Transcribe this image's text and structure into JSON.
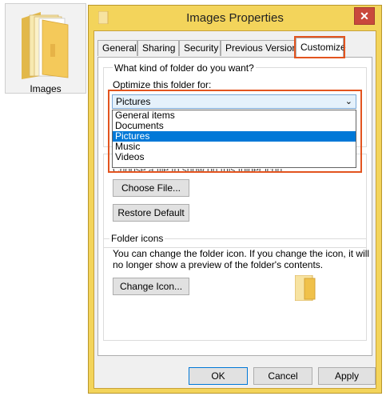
{
  "desktop": {
    "folder_label": "Images"
  },
  "window": {
    "title": "Images Properties",
    "close_label": "✕"
  },
  "tabs": [
    {
      "label": "General"
    },
    {
      "label": "Sharing"
    },
    {
      "label": "Security"
    },
    {
      "label": "Previous Versions"
    },
    {
      "label": "Customize",
      "active": true
    }
  ],
  "customize": {
    "question": "What kind of folder do you want?",
    "optimize_label": "Optimize this folder for:",
    "selected_value": "Pictures",
    "options": [
      "General items",
      "Documents",
      "Pictures",
      "Music",
      "Videos"
    ],
    "partial_text": "Choose a file to show on this folder icon.",
    "choose_file_button": "Choose File...",
    "restore_default_button": "Restore Default",
    "folder_icons_label": "Folder icons",
    "folder_icons_desc_line1": "You can change the folder icon. If you change the icon, it will",
    "folder_icons_desc_line2": "no longer show a preview of the folder's contents.",
    "change_icon_button": "Change Icon..."
  },
  "footer": {
    "ok": "OK",
    "cancel": "Cancel",
    "apply": "Apply"
  },
  "colors": {
    "highlight": "#e3541f",
    "selection": "#0078d7",
    "titlebar": "#f3d45b",
    "close": "#c9483c"
  }
}
